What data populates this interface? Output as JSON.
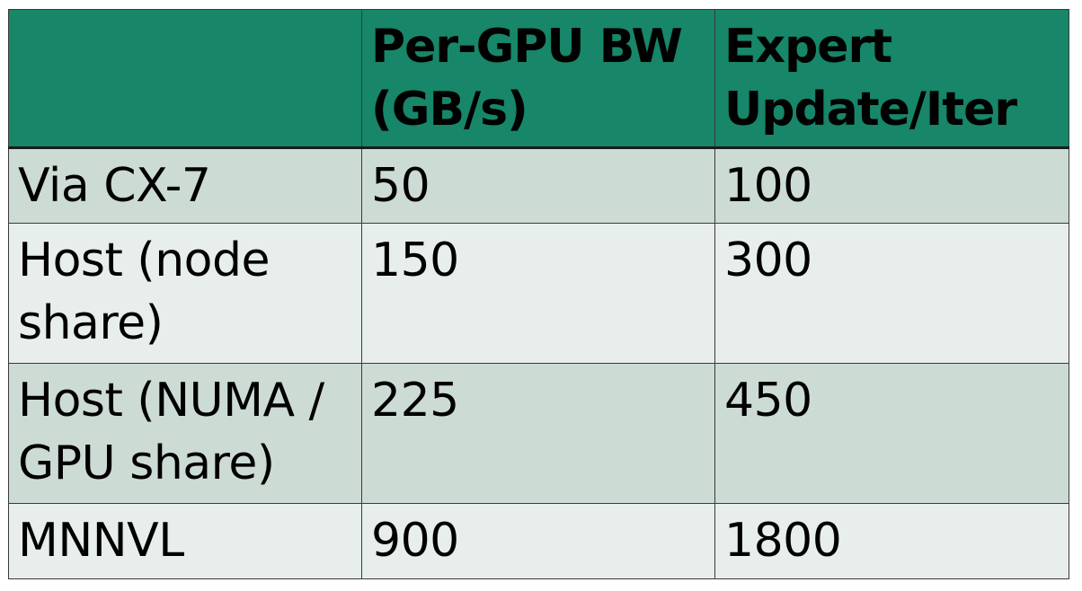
{
  "table": {
    "headers": [
      "",
      "Per-GPU BW (GB/s)",
      "Expert Update/Iter"
    ],
    "rows": [
      [
        "Via CX-7",
        "50",
        "100"
      ],
      [
        "Host (node share)",
        "150",
        "300"
      ],
      [
        "Host (NUMA / GPU share)",
        "225",
        "450"
      ],
      [
        "MNNVL",
        "900",
        "1800"
      ]
    ]
  },
  "colors": {
    "header_bg": "#178669",
    "row_odd_bg": "#cddbd5",
    "row_even_bg": "#e7eeeb",
    "border": "#3a3a3a"
  }
}
